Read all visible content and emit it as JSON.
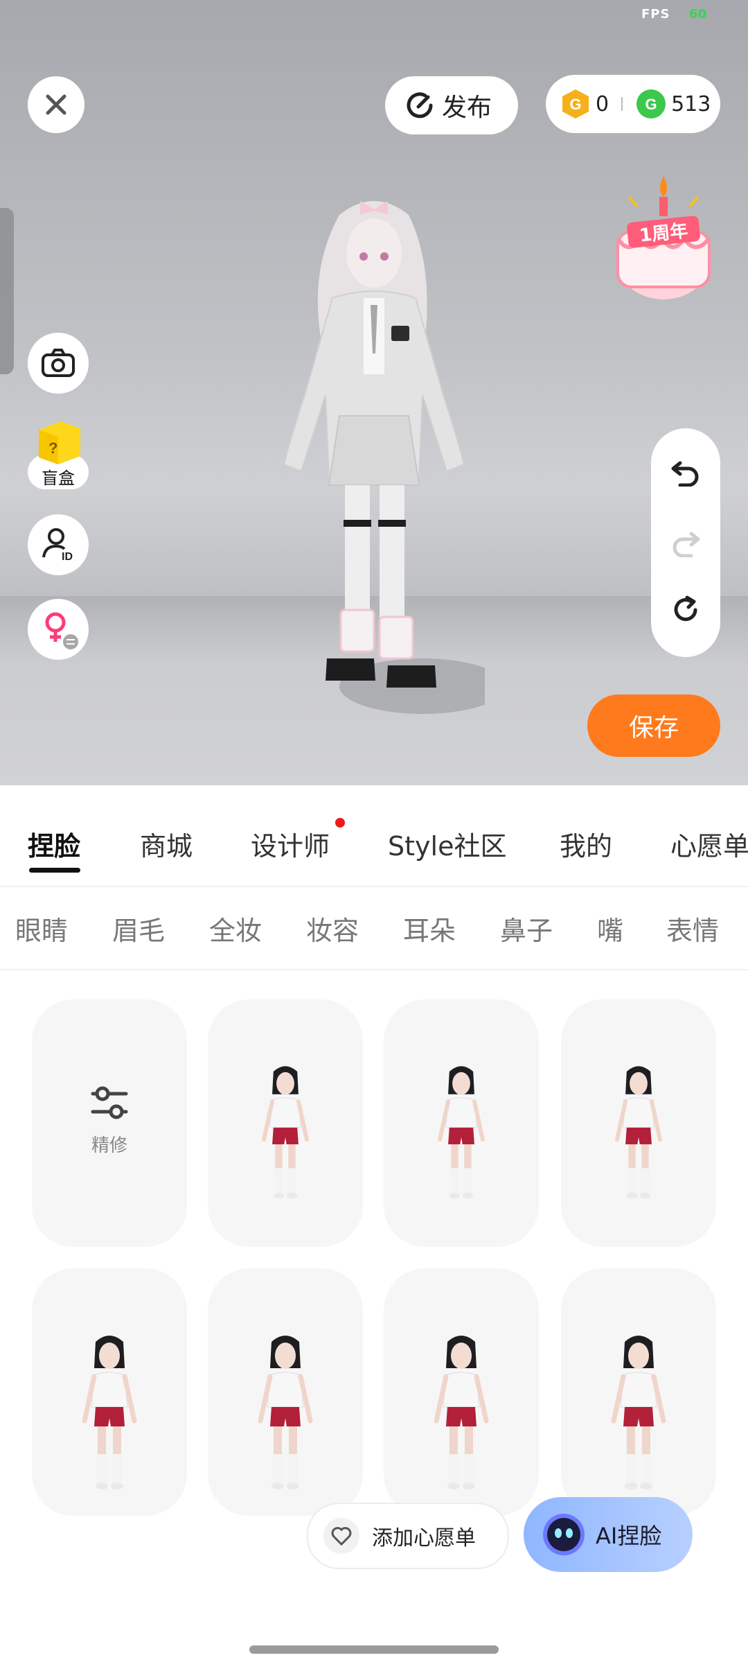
{
  "hud": {
    "fps_label": "FPS",
    "fps_value": "60"
  },
  "header": {
    "close_icon": "close-icon",
    "publish_label": "发布",
    "gold_coins": "0",
    "green_coins": "513"
  },
  "event_badge": {
    "text": "1周年"
  },
  "left_tools": {
    "camera_icon": "camera-icon",
    "blindbox_label": "盲盒",
    "id_icon": "user-id-icon",
    "gender_icon": "female-swap-icon"
  },
  "right_tools": {
    "undo_icon": "undo-icon",
    "redo_icon": "redo-icon",
    "reset_icon": "reset-icon"
  },
  "save_label": "保存",
  "tabs": [
    {
      "label": "捏脸",
      "active": true
    },
    {
      "label": "商城"
    },
    {
      "label": "设计师",
      "dot": true
    },
    {
      "label": "Style社区"
    },
    {
      "label": "我的"
    },
    {
      "label": "心愿单"
    }
  ],
  "subtabs": [
    "眼睛",
    "眉毛",
    "全妆",
    "妆容",
    "耳朵",
    "鼻子",
    "嘴",
    "表情"
  ],
  "grid": {
    "refine_label": "精修"
  },
  "wishlist_label": "添加心愿单",
  "ai_label": "AI捏脸",
  "colors": {
    "accent": "#ff7a1c",
    "active_text": "#111111",
    "inactive_text": "#777777"
  }
}
